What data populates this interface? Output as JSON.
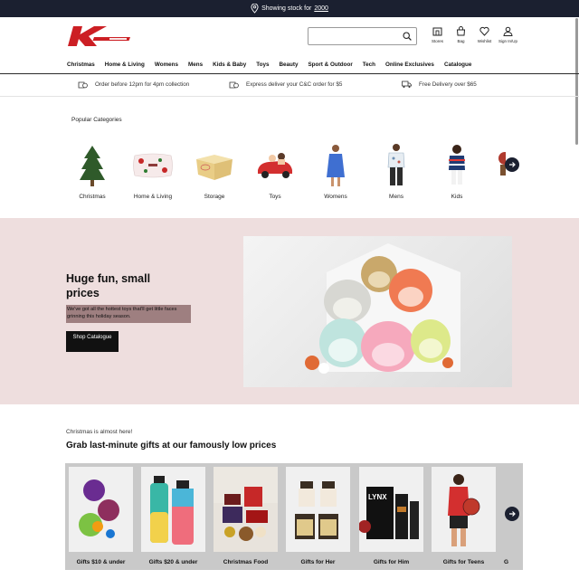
{
  "topbar": {
    "prefix": "Showing stock for",
    "postcode": "2000"
  },
  "header": {
    "search": {
      "value": "",
      "placeholder": ""
    },
    "icons": [
      {
        "label": "Stores",
        "icon": "store-icon"
      },
      {
        "label": "Bag",
        "icon": "bag-icon"
      },
      {
        "label": "Wishlist",
        "icon": "heart-icon"
      },
      {
        "label": "Sign In/Up",
        "icon": "user-icon"
      }
    ]
  },
  "nav": [
    "Christmas",
    "Home & Living",
    "Womens",
    "Mens",
    "Kids & Baby",
    "Toys",
    "Beauty",
    "Sport & Outdoor",
    "Tech",
    "Online Exclusives",
    "Catalogue"
  ],
  "usps": [
    {
      "text": "Order before 12pm for 4pm collection",
      "icon": "bag-clock-icon"
    },
    {
      "text": "Express deliver your C&C order for $5",
      "icon": "bag-express-icon"
    },
    {
      "text": "Free Delivery over $65",
      "icon": "truck-icon"
    }
  ],
  "popular": {
    "title": "Popular Categories",
    "items": [
      "Christmas",
      "Home & Living",
      "Storage",
      "Toys",
      "Womens",
      "Mens",
      "Kids"
    ]
  },
  "hero": {
    "title": "Huge fun, small prices",
    "description": "We've got all the hottest toys that'll get little faces grinning this holiday season.",
    "button": "Shop Catalogue",
    "background": "#eedede"
  },
  "gifts": {
    "subtitle": "Christmas is almost here!",
    "title": "Grab last-minute gifts at our famously low prices",
    "items": [
      "Gifts $10 & under",
      "Gifts $20 & under",
      "Christmas Food",
      "Gifts for Her",
      "Gifts for Him",
      "Gifts for Teens",
      "G"
    ]
  },
  "colors": {
    "brand": "#cc1f24",
    "dark": "#1b2030"
  }
}
